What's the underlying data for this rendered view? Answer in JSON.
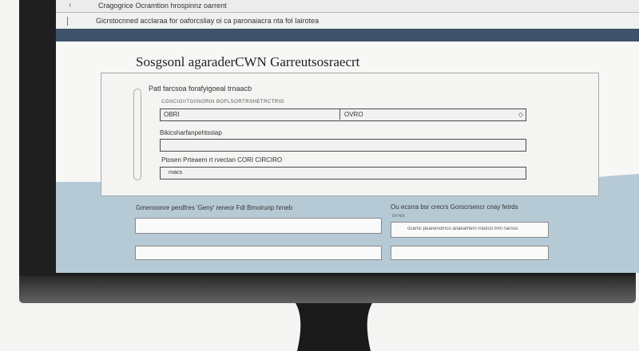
{
  "browser": {
    "tab_text": "Cragogrice Ocramtion hrospinnz oarrent",
    "address_text": "Gicrstocnned acclaraa for oaforcsliay oi ca paronaiacra nta fol Iairotea"
  },
  "page": {
    "title": "Sosgsonl agaraderCWN Garreutsosraecrt"
  },
  "form": {
    "section_label": "Patl farcsoa forafyigoeal trnaacb",
    "row1_sublabel": "CGNCIGIITGIINORIN BOFLSORTRSHETRCTRIG",
    "row1_left_value": "OBRI",
    "row1_right_value": "OVRO",
    "row2_label": "Bikicsharfanpehtsslap",
    "row3_label": "Ptosen Prteaem rt rvectan CORI CIRCIRO",
    "row3_value": "rnacs"
  },
  "lower": {
    "left_label": "Gmenoonre perdfres 'Geny' reneor Fdl Bmoirunp hrneb",
    "right_label": "Ou ecsrra bsr crecrs Gorscrsencr cnay fetrds",
    "right_sublabel": "orres",
    "right_field_value": "ocarnc peanenornco anaeamero rraorco lnm narsso"
  },
  "colors": {
    "nav_band": "#3e536a",
    "wave": "#b6cad6",
    "bezel": "#1f1f1f"
  }
}
